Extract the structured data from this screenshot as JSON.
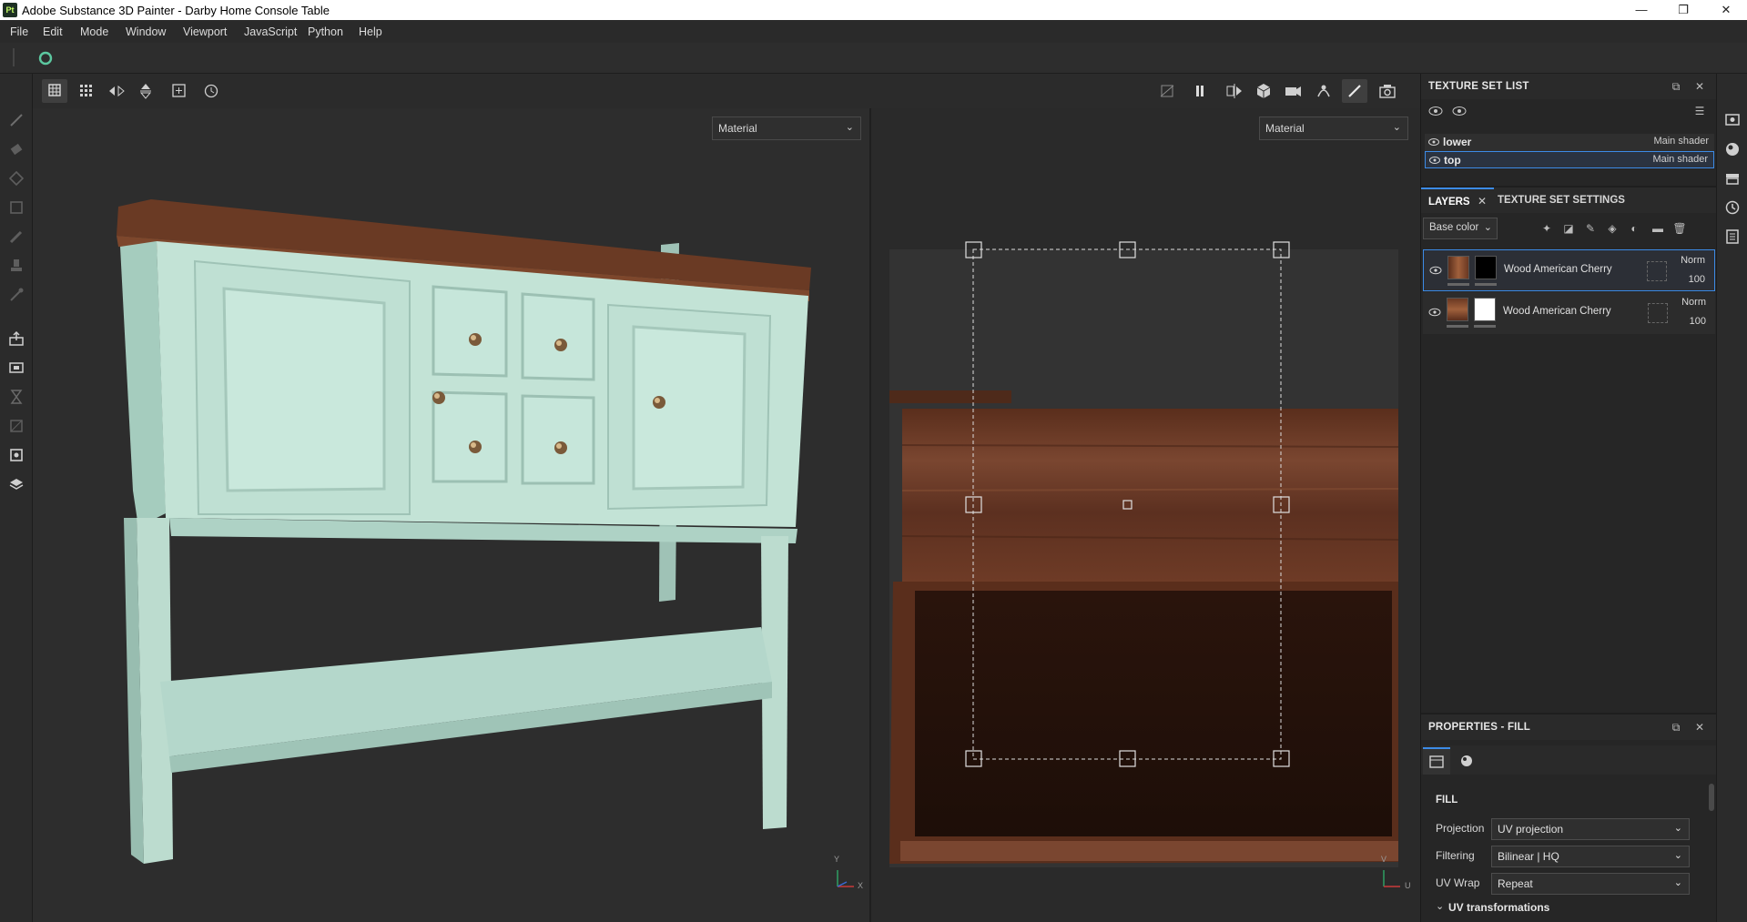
{
  "window": {
    "app_icon": "Pt",
    "title": "Adobe Substance 3D Painter - Darby Home Console Table",
    "controls": [
      "minimize-icon",
      "restore-icon",
      "close-icon"
    ]
  },
  "menu": [
    "File",
    "Edit",
    "Mode",
    "Window",
    "Viewport",
    "JavaScript",
    "Python",
    "Help"
  ],
  "viewport": {
    "left_mode": "Material",
    "right_mode": "Material",
    "axis_left": {
      "y": "Y",
      "x": "X"
    },
    "axis_right": {
      "v": "V",
      "u": "U"
    }
  },
  "texture_set_list": {
    "title": "TEXTURE SET LIST",
    "items": [
      {
        "name": "lower",
        "shader": "Main shader",
        "selected": false
      },
      {
        "name": "top",
        "shader": "Main shader",
        "selected": true
      }
    ]
  },
  "layers": {
    "tab_layers": "LAYERS",
    "tab_settings": "TEXTURE SET SETTINGS",
    "channel": "Base color",
    "items": [
      {
        "name": "Wood American Cherry",
        "blend": "Norm",
        "opacity": "100",
        "selected": true,
        "mask": "black"
      },
      {
        "name": "Wood American Cherry",
        "blend": "Norm",
        "opacity": "100",
        "selected": false,
        "mask": "white"
      }
    ]
  },
  "properties": {
    "title": "PROPERTIES - FILL",
    "section": "FILL",
    "projection_label": "Projection",
    "projection_value": "UV projection",
    "filtering_label": "Filtering",
    "filtering_value": "Bilinear | HQ",
    "uvwrap_label": "UV Wrap",
    "uvwrap_value": "Repeat",
    "uv_transformations": "UV transformations"
  },
  "colors": {
    "accent": "#3c8be6",
    "cabinet": "#b9dccf",
    "wood": "#6b3a22"
  }
}
